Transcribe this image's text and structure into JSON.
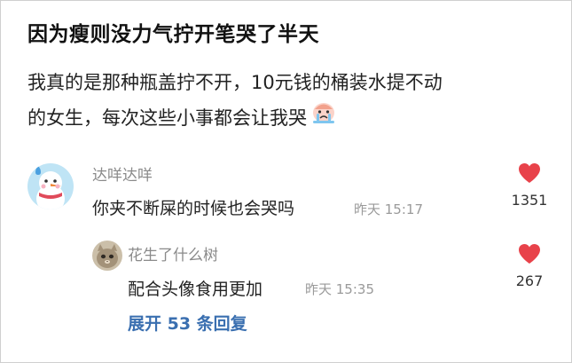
{
  "post": {
    "title": "因为瘦则没力气拧开笔哭了半天",
    "body_line1": "我真的是那种瓶盖拧不开，10元钱的桶装水提不动",
    "body_line2": "的女生，每次这些小事都会让我哭",
    "emoji": "crying-emoji"
  },
  "comments": [
    {
      "user": "达咩达咩",
      "text": "你夹不断屎的时候也会哭吗",
      "time": "昨天 15:17",
      "likes": "1351",
      "avatar": "snowman-avatar"
    }
  ],
  "reply": {
    "user": "花生了什么树",
    "text": "配合头像食用更加",
    "time": "昨天 15:35",
    "likes": "267",
    "avatar": "cat-avatar"
  },
  "expand": {
    "label": "展开 53 条回复"
  },
  "colors": {
    "like": "#e8424a",
    "link": "#3a6fb0",
    "meta": "#8a8a8a"
  }
}
